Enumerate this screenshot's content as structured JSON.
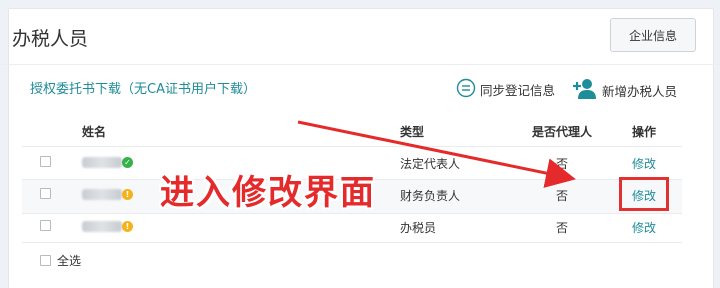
{
  "page": {
    "title": "办税人员",
    "company_button": "企业信息",
    "download_link": "授权委托书下载（无CA证书用户下载）",
    "sync_label": "同步登记信息",
    "add_label": "新增办税人员"
  },
  "table": {
    "headers": {
      "name": "姓名",
      "type": "类型",
      "agent": "是否代理人",
      "action": "操作"
    },
    "rows": [
      {
        "type": "法定代表人",
        "agent": "否",
        "action": "修改",
        "status": "verified"
      },
      {
        "type": "财务负责人",
        "agent": "否",
        "action": "修改",
        "status": "warning"
      },
      {
        "type": "办税员",
        "agent": "否",
        "action": "修改",
        "status": "warning"
      }
    ],
    "select_all": "全选"
  },
  "annotation": {
    "callout": "进入修改界面",
    "color": "#e42a2a"
  },
  "colors": {
    "link": "#1f8c9a",
    "verified": "#35b24a",
    "warning": "#f3b41b"
  }
}
